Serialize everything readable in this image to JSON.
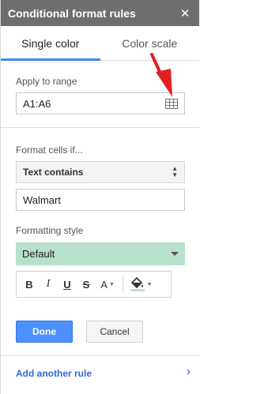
{
  "header": {
    "title": "Conditional format rules",
    "close_glyph": "✕"
  },
  "tabs": [
    {
      "label": "Single color",
      "active": true
    },
    {
      "label": "Color scale",
      "active": false
    }
  ],
  "apply_range": {
    "label": "Apply to range",
    "value": "A1:A6",
    "icon": "grid-icon"
  },
  "format_cells": {
    "label": "Format cells if...",
    "condition": "Text contains",
    "value": "Walmart"
  },
  "formatting_style": {
    "label": "Formatting style",
    "value": "Default",
    "fill_color": "#b7e1cd",
    "toolbar": {
      "bold": "B",
      "italic": "I",
      "underline": "U",
      "strikethrough": "S",
      "text_color": "A",
      "fill_icon": "paint-bucket-icon",
      "fill_indicator_color": "#b7e1cd"
    }
  },
  "buttons": {
    "done": "Done",
    "cancel": "Cancel"
  },
  "footer": {
    "add_rule": "Add another rule",
    "chevron": "›"
  },
  "colors": {
    "accent": "#4285f4",
    "done_bg": "#4d90fe",
    "header_bg": "#6e6e6e",
    "annotation_arrow": "#e02020"
  }
}
